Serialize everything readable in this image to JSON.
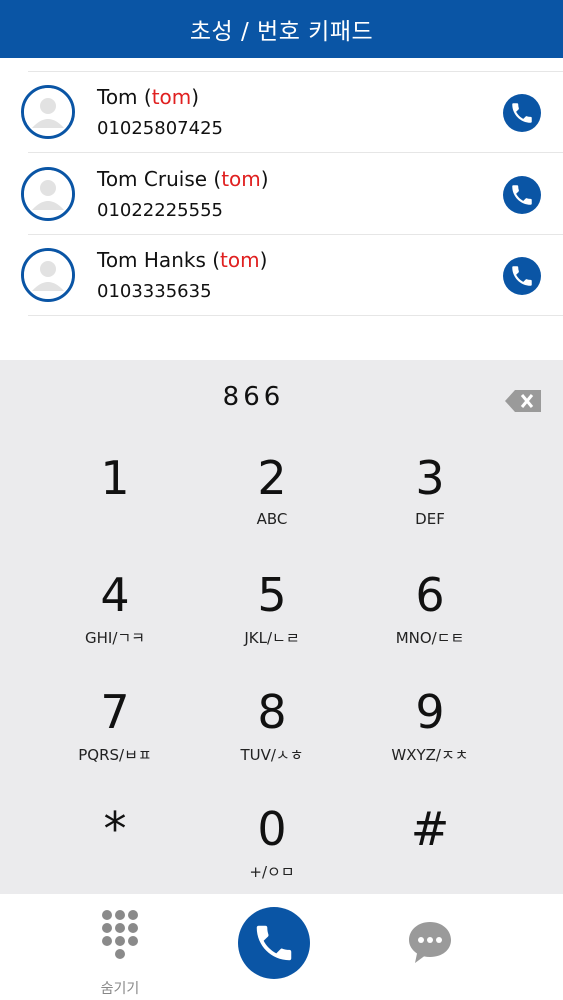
{
  "header": {
    "title": "초성 / 번호 키패드"
  },
  "contacts": [
    {
      "name": "Tom",
      "match": "tom",
      "number": "01025807425"
    },
    {
      "name": "Tom Cruise",
      "match": "tom",
      "number": "01022225555"
    },
    {
      "name": "Tom Hanks",
      "match": "tom",
      "number": "0103335635"
    }
  ],
  "keypad": {
    "display": "866",
    "keys": [
      {
        "digit": "1",
        "letters": ""
      },
      {
        "digit": "2",
        "letters": "ABC"
      },
      {
        "digit": "3",
        "letters": "DEF"
      },
      {
        "digit": "4",
        "letters": "GHI/ㄱㅋ"
      },
      {
        "digit": "5",
        "letters": "JKL/ㄴㄹ"
      },
      {
        "digit": "6",
        "letters": "MNO/ㄷㅌ"
      },
      {
        "digit": "7",
        "letters": "PQRS/ㅂㅍ"
      },
      {
        "digit": "8",
        "letters": "TUV/ㅅㅎ"
      },
      {
        "digit": "9",
        "letters": "WXYZ/ㅈㅊ"
      },
      {
        "digit": "*",
        "letters": ""
      },
      {
        "digit": "0",
        "letters": "+/ㅇㅁ"
      },
      {
        "digit": "#",
        "letters": ""
      }
    ]
  },
  "bottombar": {
    "hide_label": "숨기기"
  },
  "colors": {
    "brand": "#0a55a5",
    "highlight": "#e02020",
    "keypad_bg": "#ebebed"
  },
  "icons": [
    "person-icon",
    "phone-icon",
    "backspace-icon",
    "dialpad-icon",
    "chat-bubble-icon"
  ]
}
